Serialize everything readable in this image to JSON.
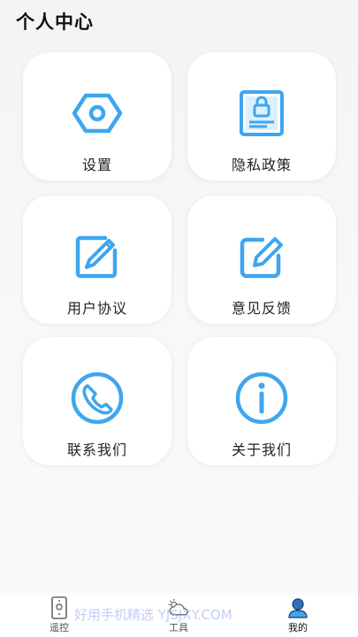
{
  "header": {
    "title": "个人中心"
  },
  "menu": {
    "settings": {
      "label": "设置",
      "icon": "hexagon-nut-icon"
    },
    "privacy_policy": {
      "label": "隐私政策",
      "icon": "lock-document-icon"
    },
    "user_agreement": {
      "label": "用户协议",
      "icon": "edit-document-icon"
    },
    "feedback": {
      "label": "意见反馈",
      "icon": "pencil-square-icon"
    },
    "contact_us": {
      "label": "联系我们",
      "icon": "phone-circle-icon"
    },
    "about_us": {
      "label": "关于我们",
      "icon": "info-circle-icon"
    }
  },
  "tabs": [
    {
      "label": "遥控",
      "icon": "remote-icon"
    },
    {
      "label": "工具",
      "icon": "cloud-sun-icon"
    },
    {
      "label": "我的",
      "icon": "user-icon",
      "active": true
    }
  ],
  "watermark": "好用手机精选 YJSJXY.COM",
  "colors": {
    "accent": "#3ea6ef",
    "card": "#ffffff",
    "text": "#222222"
  }
}
